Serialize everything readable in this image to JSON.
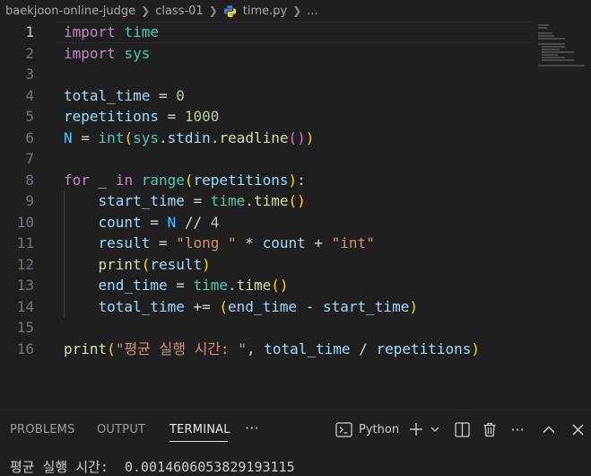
{
  "breadcrumb": {
    "items": [
      "baekjoon-online-judge",
      "class-01",
      "time.py",
      "..."
    ],
    "separator": ">"
  },
  "editor": {
    "active_line": 1,
    "lines": [
      {
        "n": "1"
      },
      {
        "n": "2"
      },
      {
        "n": "3"
      },
      {
        "n": "4"
      },
      {
        "n": "5"
      },
      {
        "n": "6"
      },
      {
        "n": "7"
      },
      {
        "n": "8"
      },
      {
        "n": "9"
      },
      {
        "n": "10"
      },
      {
        "n": "11"
      },
      {
        "n": "12"
      },
      {
        "n": "13"
      },
      {
        "n": "14"
      },
      {
        "n": "15"
      },
      {
        "n": "16"
      }
    ],
    "code": [
      [
        [
          "kw",
          "import"
        ],
        [
          "op",
          " "
        ],
        [
          "cls",
          "time"
        ]
      ],
      [
        [
          "kw",
          "import"
        ],
        [
          "op",
          " "
        ],
        [
          "cls",
          "sys"
        ]
      ],
      [],
      [
        [
          "id",
          "total_time"
        ],
        [
          "op",
          " = "
        ],
        [
          "num",
          "0"
        ]
      ],
      [
        [
          "id",
          "repetitions"
        ],
        [
          "op",
          " = "
        ],
        [
          "num",
          "1000"
        ]
      ],
      [
        [
          "const",
          "N"
        ],
        [
          "op",
          " = "
        ],
        [
          "cls",
          "int"
        ],
        [
          "bb1",
          "("
        ],
        [
          "cls",
          "sys"
        ],
        [
          "op",
          "."
        ],
        [
          "id",
          "stdin"
        ],
        [
          "op",
          "."
        ],
        [
          "fn",
          "readline"
        ],
        [
          "bb2",
          "()"
        ],
        [
          "bb1",
          ")"
        ]
      ],
      [],
      [
        [
          "kw",
          "for"
        ],
        [
          "op",
          " _ "
        ],
        [
          "kw",
          "in"
        ],
        [
          "op",
          " "
        ],
        [
          "cls",
          "range"
        ],
        [
          "bb1",
          "("
        ],
        [
          "id",
          "repetitions"
        ],
        [
          "bb1",
          ")"
        ],
        [
          "op",
          ":"
        ]
      ],
      [
        [
          "op",
          "    "
        ],
        [
          "id",
          "start_time"
        ],
        [
          "op",
          " = "
        ],
        [
          "cls",
          "time"
        ],
        [
          "op",
          "."
        ],
        [
          "fn",
          "time"
        ],
        [
          "bb1",
          "()"
        ]
      ],
      [
        [
          "op",
          "    "
        ],
        [
          "id",
          "count"
        ],
        [
          "op",
          " = "
        ],
        [
          "const",
          "N"
        ],
        [
          "op",
          " // "
        ],
        [
          "num",
          "4"
        ]
      ],
      [
        [
          "op",
          "    "
        ],
        [
          "id",
          "result"
        ],
        [
          "op",
          " = "
        ],
        [
          "str",
          "\"long \""
        ],
        [
          "op",
          " * "
        ],
        [
          "id",
          "count"
        ],
        [
          "op",
          " + "
        ],
        [
          "str",
          "\"int\""
        ]
      ],
      [
        [
          "op",
          "    "
        ],
        [
          "fn",
          "print"
        ],
        [
          "bb1",
          "("
        ],
        [
          "id",
          "result"
        ],
        [
          "bb1",
          ")"
        ]
      ],
      [
        [
          "op",
          "    "
        ],
        [
          "id",
          "end_time"
        ],
        [
          "op",
          " = "
        ],
        [
          "cls",
          "time"
        ],
        [
          "op",
          "."
        ],
        [
          "fn",
          "time"
        ],
        [
          "bb1",
          "()"
        ]
      ],
      [
        [
          "op",
          "    "
        ],
        [
          "id",
          "total_time"
        ],
        [
          "op",
          " += "
        ],
        [
          "bb1",
          "("
        ],
        [
          "id",
          "end_time"
        ],
        [
          "op",
          " - "
        ],
        [
          "id",
          "start_time"
        ],
        [
          "bb1",
          ")"
        ]
      ],
      [],
      [
        [
          "fn",
          "print"
        ],
        [
          "bb1",
          "("
        ],
        [
          "str",
          "\"평균 실행 시간: \""
        ],
        [
          "op",
          ", "
        ],
        [
          "id",
          "total_time"
        ],
        [
          "op",
          " / "
        ],
        [
          "id",
          "repetitions"
        ],
        [
          "bb1",
          ")"
        ]
      ]
    ]
  },
  "panel": {
    "tabs": [
      "PROBLEMS",
      "OUTPUT",
      "TERMINAL"
    ],
    "active_tab": "TERMINAL",
    "more_label": "···",
    "terminal_profile": "Python",
    "terminal_output": "평균 실행 시간:  0.0014606053829193115"
  },
  "colors": {
    "background": "#1f1f1f",
    "keyword": "#c586c0",
    "variable": "#9cdcfe",
    "function": "#dcdcaa",
    "number": "#b5cea8",
    "string": "#ce9178",
    "bracket_level1": "#ffd700",
    "bracket_level2": "#da70d6",
    "module": "#4ec9b0",
    "constant": "#4fc1ff"
  },
  "icons": [
    "chevron-right-icon",
    "python-file-icon",
    "terminal-icon",
    "plus-icon",
    "chevron-down-icon",
    "split-icon",
    "trash-icon",
    "ellipsis-icon",
    "chevron-up-icon",
    "close-icon"
  ]
}
